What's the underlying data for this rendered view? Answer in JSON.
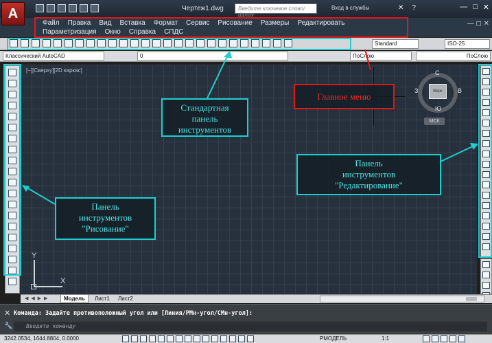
{
  "app": {
    "logo": "A",
    "doc_title": "Чертеж1.dwg",
    "search_placeholder": "Введите ключевое слово/фразу",
    "login": "Вход в службы",
    "help": "?"
  },
  "menu": {
    "row1": [
      "Файл",
      "Правка",
      "Вид",
      "Вставка",
      "Формат",
      "Сервис",
      "Рисование",
      "Размеры",
      "Редактировать"
    ],
    "row2": [
      "Параметризация",
      "Окно",
      "Справка",
      "СПДС"
    ]
  },
  "toolbar": {
    "text_style": "Standard",
    "dim_style": "ISO-25"
  },
  "layers": {
    "workspace": "Классический AutoCAD",
    "current_layer": "0",
    "color": "ПоСлою",
    "linetype": "ПоСлою"
  },
  "canvas": {
    "view_label": "[−][Сверху][2D каркас]",
    "viewcube": {
      "face": "Верх",
      "north": "С",
      "south": "Ю",
      "east": "В",
      "west": "З",
      "wcs": "МСК"
    },
    "ucs_x": "X",
    "ucs_y": "Y"
  },
  "callouts": {
    "main_menu": "Главное меню",
    "standard": [
      "Стандартная",
      "панель",
      "инструментов"
    ],
    "modify": [
      "Панель",
      "инструментов",
      "\"Редактирование\""
    ],
    "draw": [
      "Панель",
      "инструментов",
      "\"Рисование\""
    ]
  },
  "tabs": {
    "nav": "◀ ◀ ▶ ▶",
    "model": "Модель",
    "sheet1": "Лист1",
    "sheet2": "Лист2"
  },
  "command": {
    "prompt": "Команда: Задайте противоположный угол или [Линия/РМн-угол/СМн-угол]:",
    "input_placeholder": "Введите команду"
  },
  "status": {
    "coords": "3242.0534, 1644.8804, 0.0000",
    "space": "РМОДЕЛЬ",
    "scale": "1:1"
  }
}
